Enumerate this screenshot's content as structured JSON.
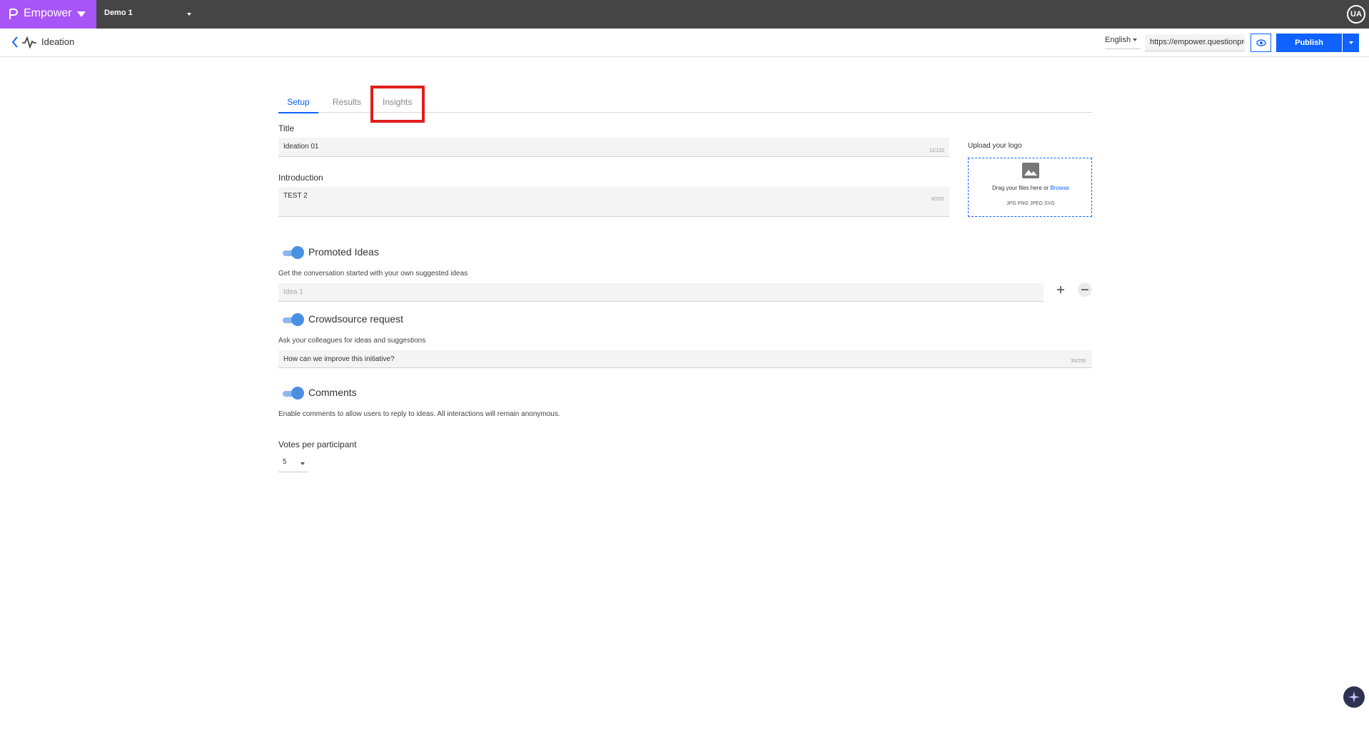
{
  "app": {
    "name": "Empower",
    "workspace": "Demo 1",
    "user_initials": "UA"
  },
  "header": {
    "title": "Ideation",
    "language": "English",
    "url": "https://empower.questionpro.com",
    "publish_label": "Publish"
  },
  "tabs": [
    {
      "label": "Setup",
      "active": true
    },
    {
      "label": "Results",
      "active": false
    },
    {
      "label": "Insights",
      "active": false
    }
  ],
  "form": {
    "title": {
      "label": "Title",
      "value": "Ideation 01",
      "counter": "11/120"
    },
    "introduction": {
      "label": "Introduction",
      "value": "TEST 2",
      "counter": "6/255"
    },
    "logo": {
      "label": "Upload your logo",
      "drag_text": "Drag your files here or",
      "browse": "Browse",
      "types": "JPG PNG JPEG SVG"
    },
    "promoted_ideas": {
      "title": "Promoted Ideas",
      "help": "Get the conversation started with your own suggested ideas",
      "placeholder": "Idea 1",
      "enabled": true
    },
    "crowdsource": {
      "title": "Crowdsource request",
      "help": "Ask your colleagues for ideas and suggestions",
      "value": "How can we improve this initiative?",
      "counter": "35/255",
      "enabled": true
    },
    "comments": {
      "title": "Comments",
      "help": "Enable comments to allow users to reply to ideas. All interactions will remain anonymous.",
      "enabled": true
    },
    "votes": {
      "label": "Votes per participant",
      "value": "5"
    }
  },
  "icons": {
    "brand": "empower-logo-icon",
    "back": "chevron-left-icon",
    "activity": "pulse-icon",
    "preview": "eye-icon",
    "image": "image-icon",
    "add": "plus-icon",
    "remove": "minus-icon",
    "assistant": "sparkle-icon"
  },
  "colors": {
    "brand": "#a855f7",
    "topbar": "#454545",
    "primary": "#0f62fe",
    "highlight": "#e11d1d",
    "toggle": "#4a90e2"
  }
}
